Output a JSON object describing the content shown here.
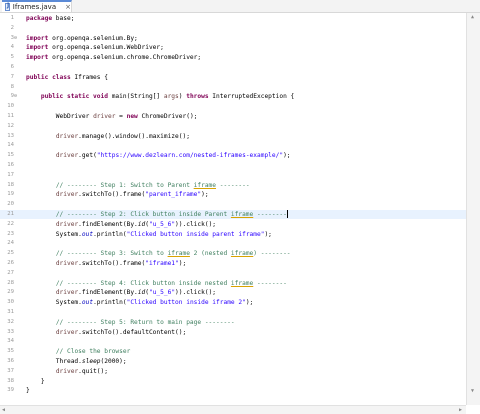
{
  "tab": {
    "title": "Iframes.java",
    "close": "×",
    "icon": "java-file-icon"
  },
  "lines": [
    {
      "n": "1",
      "fold": "",
      "html": "<span class=\"kw\">package</span> base;"
    },
    {
      "n": "2",
      "fold": "",
      "html": ""
    },
    {
      "n": "3",
      "fold": "⊖",
      "html": "<span class=\"kw\">import</span> org.openqa.selenium.By;"
    },
    {
      "n": "4",
      "fold": "",
      "html": "<span class=\"kw\">import</span> org.openqa.selenium.WebDriver;"
    },
    {
      "n": "5",
      "fold": "",
      "html": "<span class=\"kw\">import</span> org.openqa.selenium.chrome.ChromeDriver;"
    },
    {
      "n": "6",
      "fold": "",
      "html": ""
    },
    {
      "n": "7",
      "fold": "",
      "html": "<span class=\"kw\">public class</span> Iframes {"
    },
    {
      "n": "8",
      "fold": "",
      "html": ""
    },
    {
      "n": "9",
      "fold": "⊖",
      "html": "    <span class=\"kw\">public static void</span> main(String[] <span class=\"vr\">args</span>) <span class=\"kw\">throws</span> InterruptedException {"
    },
    {
      "n": "10",
      "fold": "",
      "html": ""
    },
    {
      "n": "11",
      "fold": "",
      "html": "        WebDriver <span class=\"vr\">driver</span> = <span class=\"kw\">new</span> ChromeDriver();"
    },
    {
      "n": "12",
      "fold": "",
      "html": ""
    },
    {
      "n": "13",
      "fold": "",
      "html": "        <span class=\"vr\">driver</span>.manage().window().maximize();"
    },
    {
      "n": "14",
      "fold": "",
      "html": ""
    },
    {
      "n": "15",
      "fold": "",
      "html": "        <span class=\"vr\">driver</span>.get(<span class=\"str\">\"https://www.dezlearn.com/nested-iframes-example/\"</span>);"
    },
    {
      "n": "16",
      "fold": "",
      "html": ""
    },
    {
      "n": "17",
      "fold": "",
      "html": ""
    },
    {
      "n": "18",
      "fold": "",
      "html": "        <span class=\"cm\">// -------- Step 1: Switch to Parent <span class=\"uline\">iframe</span> --------</span>"
    },
    {
      "n": "19",
      "fold": "",
      "html": "        <span class=\"vr\">driver</span>.switchTo().frame(<span class=\"str\">\"parent_iframe\"</span>);"
    },
    {
      "n": "20",
      "fold": "",
      "html": ""
    },
    {
      "n": "21",
      "fold": "",
      "current": true,
      "html": "        <span class=\"cm\">// -------- Step 2: Click button inside Parent <span class=\"uline\">iframe</span> --------</span><span class=\"caret\"></span>"
    },
    {
      "n": "22",
      "fold": "",
      "html": "        <span class=\"vr\">driver</span>.findElement(By.<span class=\"sm\">id</span>(<span class=\"str\">\"u_5_6\"</span>)).click();"
    },
    {
      "n": "23",
      "fold": "",
      "html": "        System.<span class=\"fld\">out</span>.println(<span class=\"str\">\"Clicked button inside parent iframe\"</span>);"
    },
    {
      "n": "24",
      "fold": "",
      "html": ""
    },
    {
      "n": "25",
      "fold": "",
      "html": "        <span class=\"cm\">// -------- Step 3: Switch to <span class=\"uline\">iframe</span> 2 (nested <span class=\"uline\">iframe</span>) --------</span>"
    },
    {
      "n": "26",
      "fold": "",
      "html": "        <span class=\"vr\">driver</span>.switchTo().frame(<span class=\"str\">\"iframe1\"</span>);"
    },
    {
      "n": "27",
      "fold": "",
      "html": ""
    },
    {
      "n": "28",
      "fold": "",
      "html": "        <span class=\"cm\">// -------- Step 4: Click button inside nested <span class=\"uline\">iframe</span> --------</span>"
    },
    {
      "n": "29",
      "fold": "",
      "html": "        <span class=\"vr\">driver</span>.findElement(By.<span class=\"sm\">id</span>(<span class=\"str\">\"u_5_6\"</span>)).click();"
    },
    {
      "n": "30",
      "fold": "",
      "html": "        System.<span class=\"fld\">out</span>.println(<span class=\"str\">\"Clicked button inside iframe 2\"</span>);"
    },
    {
      "n": "31",
      "fold": "",
      "html": ""
    },
    {
      "n": "32",
      "fold": "",
      "html": "        <span class=\"cm\">// -------- Step 5: Return to main page --------</span>"
    },
    {
      "n": "33",
      "fold": "",
      "html": "        <span class=\"vr\">driver</span>.switchTo().defaultContent();"
    },
    {
      "n": "34",
      "fold": "",
      "html": ""
    },
    {
      "n": "35",
      "fold": "",
      "html": "        <span class=\"cm\">// Close the browser</span>"
    },
    {
      "n": "36",
      "fold": "",
      "html": "        Thread.<span class=\"sm\">sleep</span>(2000);"
    },
    {
      "n": "37",
      "fold": "",
      "html": "        <span class=\"vr\">driver</span>.quit();"
    },
    {
      "n": "38",
      "fold": "",
      "html": "    }"
    },
    {
      "n": "39",
      "fold": "",
      "html": "}"
    }
  ]
}
